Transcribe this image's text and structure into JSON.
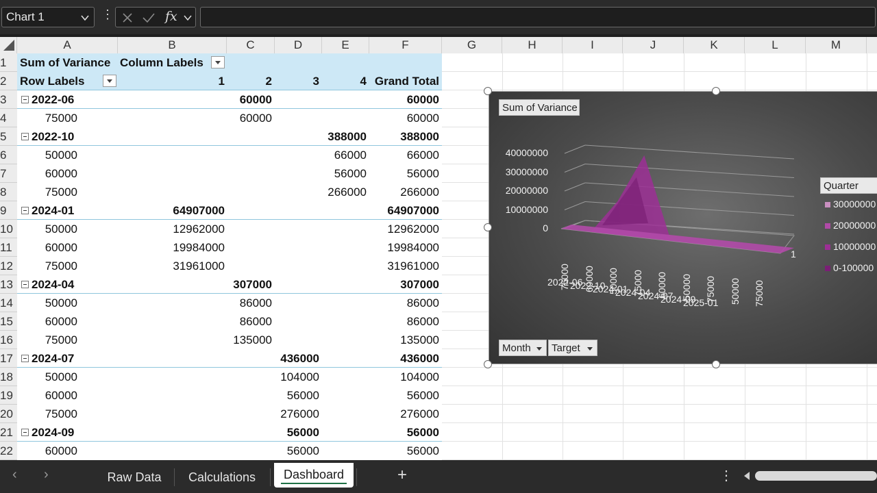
{
  "formula_bar": {
    "name_box": "Chart 1",
    "fx_label": "fx",
    "formula": ""
  },
  "columns": [
    "A",
    "B",
    "C",
    "D",
    "E",
    "F",
    "G",
    "H",
    "I",
    "J",
    "K",
    "L",
    "M"
  ],
  "rows": [
    "1",
    "2",
    "3",
    "4",
    "5",
    "6",
    "7",
    "8",
    "9",
    "10",
    "11",
    "12",
    "13",
    "14",
    "15",
    "16",
    "17",
    "18",
    "19",
    "20",
    "21",
    "22"
  ],
  "pivot": {
    "header1": {
      "a": "Sum of Variance",
      "b": "Column Labels"
    },
    "header2": {
      "a": "Row Labels",
      "b": "1",
      "c": "2",
      "d": "3",
      "e": "4",
      "f": "Grand Total"
    },
    "data_rows": [
      {
        "label": "2022-06",
        "group": true,
        "b": "",
        "c": "60000",
        "d": "",
        "e": "",
        "f": "60000"
      },
      {
        "label": "75000",
        "group": false,
        "b": "",
        "c": "60000",
        "d": "",
        "e": "",
        "f": "60000"
      },
      {
        "label": "2022-10",
        "group": true,
        "b": "",
        "c": "",
        "d": "",
        "e": "388000",
        "f": "388000"
      },
      {
        "label": "50000",
        "group": false,
        "b": "",
        "c": "",
        "d": "",
        "e": "66000",
        "f": "66000"
      },
      {
        "label": "60000",
        "group": false,
        "b": "",
        "c": "",
        "d": "",
        "e": "56000",
        "f": "56000"
      },
      {
        "label": "75000",
        "group": false,
        "b": "",
        "c": "",
        "d": "",
        "e": "266000",
        "f": "266000"
      },
      {
        "label": "2024-01",
        "group": true,
        "b": "64907000",
        "c": "",
        "d": "",
        "e": "",
        "f": "64907000"
      },
      {
        "label": "50000",
        "group": false,
        "b": "12962000",
        "c": "",
        "d": "",
        "e": "",
        "f": "12962000"
      },
      {
        "label": "60000",
        "group": false,
        "b": "19984000",
        "c": "",
        "d": "",
        "e": "",
        "f": "19984000"
      },
      {
        "label": "75000",
        "group": false,
        "b": "31961000",
        "c": "",
        "d": "",
        "e": "",
        "f": "31961000"
      },
      {
        "label": "2024-04",
        "group": true,
        "b": "",
        "c": "307000",
        "d": "",
        "e": "",
        "f": "307000"
      },
      {
        "label": "50000",
        "group": false,
        "b": "",
        "c": "86000",
        "d": "",
        "e": "",
        "f": "86000"
      },
      {
        "label": "60000",
        "group": false,
        "b": "",
        "c": "86000",
        "d": "",
        "e": "",
        "f": "86000"
      },
      {
        "label": "75000",
        "group": false,
        "b": "",
        "c": "135000",
        "d": "",
        "e": "",
        "f": "135000"
      },
      {
        "label": "2024-07",
        "group": true,
        "b": "",
        "c": "",
        "d": "436000",
        "e": "",
        "f": "436000"
      },
      {
        "label": "50000",
        "group": false,
        "b": "",
        "c": "",
        "d": "104000",
        "e": "",
        "f": "104000"
      },
      {
        "label": "60000",
        "group": false,
        "b": "",
        "c": "",
        "d": "56000",
        "e": "",
        "f": "56000"
      },
      {
        "label": "75000",
        "group": false,
        "b": "",
        "c": "",
        "d": "276000",
        "e": "",
        "f": "276000"
      },
      {
        "label": "2024-09",
        "group": true,
        "b": "",
        "c": "",
        "d": "56000",
        "e": "",
        "f": "56000"
      },
      {
        "label": "60000",
        "group": false,
        "b": "",
        "c": "",
        "d": "56000",
        "e": "",
        "f": "56000"
      }
    ]
  },
  "chart": {
    "title_button": "Sum of Variance",
    "legend_title": "Quarter",
    "legend_items": [
      {
        "label": "30000000",
        "color": "#c98fc0"
      },
      {
        "label": "20000000",
        "color": "#b14aa8"
      },
      {
        "label": "10000000",
        "color": "#9c2f95"
      },
      {
        "label": "0-100000",
        "color": "#7a1f75"
      }
    ],
    "field_buttons": [
      "Month",
      "Target"
    ],
    "depth_label": "1"
  },
  "chart_data": {
    "type": "area",
    "y_ticks": [
      "40000000",
      "30000000",
      "20000000",
      "10000000",
      "0"
    ],
    "ylim": [
      0,
      40000000
    ],
    "x_categories": [
      "75000",
      "60000",
      "50000",
      "75000",
      "60000",
      "50000",
      "75000",
      "50000",
      "75000"
    ],
    "x_groups": [
      "2022-06",
      "2022-10",
      "2024-01",
      "2024-04",
      "2024-07",
      "2024-09",
      "2025-01"
    ],
    "series": [
      {
        "values": [
          0,
          0,
          12962000,
          31961000,
          0,
          0,
          0,
          0,
          0
        ]
      }
    ],
    "colors": [
      "#9c2f95"
    ]
  },
  "sheet_tabs": {
    "tabs": [
      "Raw Data",
      "Calculations",
      "Dashboard"
    ],
    "active": "Dashboard",
    "add_label": "+"
  }
}
